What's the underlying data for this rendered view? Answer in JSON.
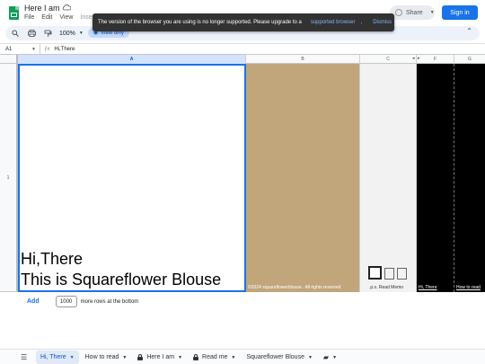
{
  "app": {
    "doc_title": "Here I am",
    "menu": [
      "File",
      "Edit",
      "View",
      "Insert"
    ],
    "share_label": "Share",
    "signin_label": "Sign in"
  },
  "notice": {
    "message": "The version of the browser you are using is no longer supported. Please upgrade to a",
    "link": "supported browser",
    "dot": ".",
    "dismiss": "Dismiss"
  },
  "toolbar": {
    "zoom": "100%",
    "view_only": "View only"
  },
  "formula": {
    "cell_ref": "A1",
    "content": "Hi,There"
  },
  "grid": {
    "columns": [
      "A",
      "B",
      "C",
      "F",
      "G"
    ],
    "row_label": "1",
    "cell_a_line1": "Hi,There",
    "cell_a_line2": "This is Squareflower Blouse",
    "cell_b_text": "©2024 squareflowerblouse.. All rights reserved",
    "cell_c_text": ".p.s. Read Memo",
    "cell_f_text": "Hi, There",
    "cell_g_text": "How to read"
  },
  "addrows": {
    "add_label": "Add",
    "count": "1000",
    "suffix": "more rows at the bottom"
  },
  "sheets": [
    {
      "label": "Hi, There",
      "locked": false
    },
    {
      "label": "How to read",
      "locked": false
    },
    {
      "label": "Here I am",
      "locked": true
    },
    {
      "label": "Read me",
      "locked": true
    },
    {
      "label": "Squareflower Blouse",
      "locked": false
    }
  ],
  "colors": {
    "accent": "#1a73e8",
    "cell_b_bg": "#c0a67a",
    "sheets_green": "#0f9d58"
  }
}
